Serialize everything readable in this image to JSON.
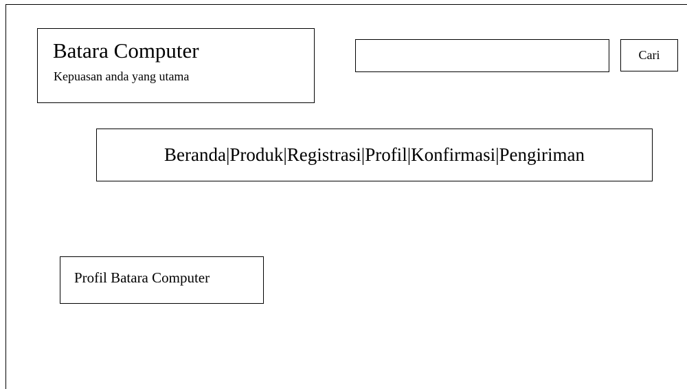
{
  "brand": {
    "name": "Batara Computer",
    "tagline": "Kepuasan anda yang utama"
  },
  "search": {
    "value": "",
    "placeholder": "",
    "button_label": "Cari"
  },
  "nav": {
    "separator": "|",
    "items": [
      {
        "label": "Beranda"
      },
      {
        "label": "Produk"
      },
      {
        "label": "Registrasi"
      },
      {
        "label": "Profil"
      },
      {
        "label": "Konfirmasi"
      },
      {
        "label": "Pengiriman"
      }
    ]
  },
  "main": {
    "section_title": "Profil Batara Computer"
  }
}
